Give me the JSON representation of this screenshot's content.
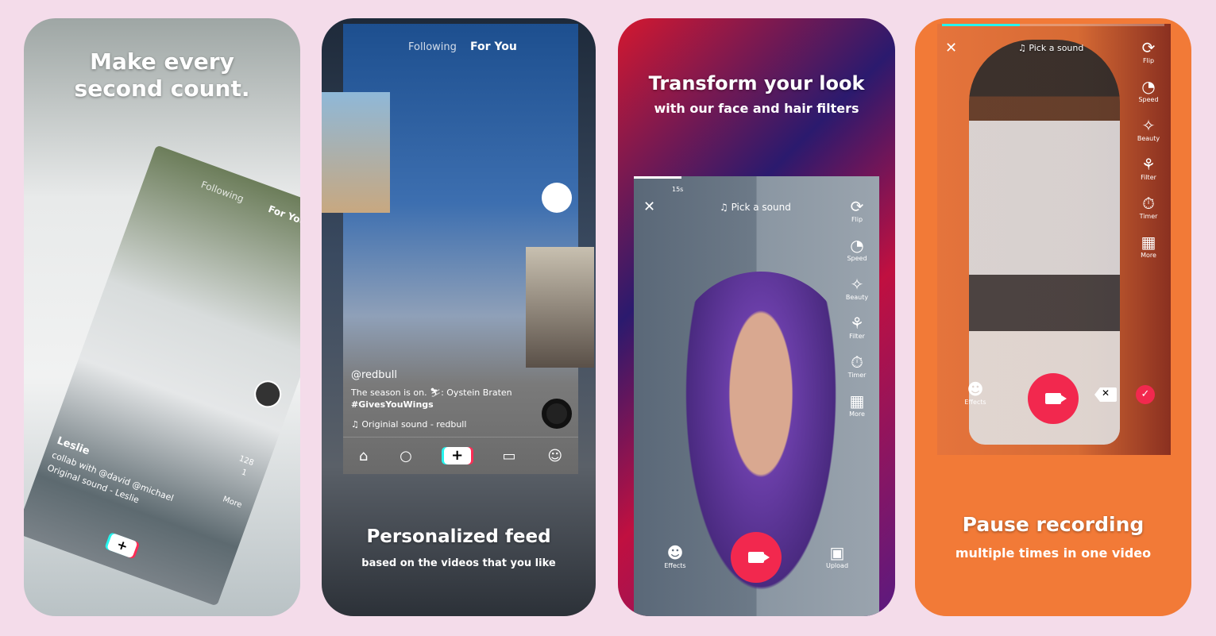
{
  "cards": [
    {
      "headline": "Make every second count.",
      "feed": {
        "tab_following": "Following",
        "tab_foryou": "For You",
        "username": "Leslie",
        "caption": "collab with @david @michael",
        "sound": "Original sound - Leslie",
        "count1": "128",
        "count2": "1",
        "more": "More"
      }
    },
    {
      "headline": "Personalized feed",
      "subline": "based on the videos that you like",
      "feed": {
        "tab_following": "Following",
        "tab_foryou": "For You",
        "username": "@redbull",
        "caption": "The season is on. ⛷: Oystein Braten",
        "hashtag": "#GivesYouWings",
        "sound": "Originial sound - redbull"
      }
    },
    {
      "headline": "Transform your look",
      "subline": "with our face and hair filters",
      "camera": {
        "timer": "15s",
        "pick_sound": "Pick a sound",
        "tools": [
          "Flip",
          "Speed",
          "Beauty",
          "Filter",
          "Timer",
          "More"
        ],
        "effects": "Effects",
        "upload": "Upload"
      }
    },
    {
      "headline": "Pause recording",
      "subline": "multiple times in one video",
      "camera": {
        "pick_sound": "Pick a sound",
        "tools": [
          "Flip",
          "Speed",
          "Beauty",
          "Filter",
          "Timer",
          "More"
        ],
        "effects": "Effects"
      }
    }
  ],
  "colors": {
    "background": "#f4dcea",
    "record": "#f2284e",
    "accent_cyan": "#25f4ee",
    "accent_red": "#fe2c55",
    "card4": "#f27a37"
  },
  "progress_card4": 0.35
}
